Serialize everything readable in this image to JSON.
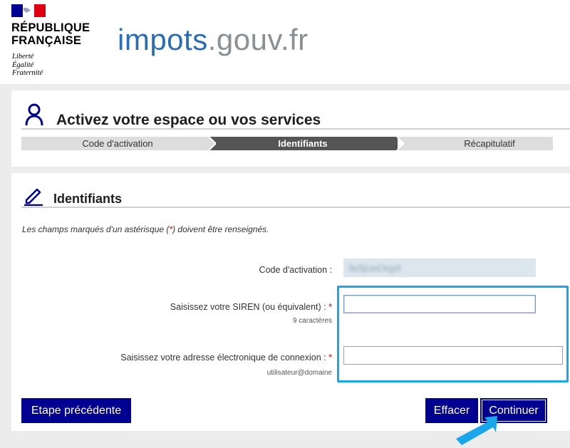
{
  "header": {
    "republic_line1": "RÉPUBLIQUE",
    "republic_line2": "FRANÇAISE",
    "motto": [
      "Liberté",
      "Égalité",
      "Fraternité"
    ],
    "logo_part1": "impots",
    "logo_part2": ".gouv.fr"
  },
  "activation": {
    "title": "Activez votre espace ou vos services",
    "steps": [
      {
        "label": "Code d'activation",
        "state": "done"
      },
      {
        "label": "Identifiants",
        "state": "current"
      },
      {
        "label": "Récapitulatif",
        "state": "todo"
      }
    ]
  },
  "form": {
    "section_title": "Identifiants",
    "note_before": "Les champs marqués d'un astérisque (",
    "note_star": "*",
    "note_after": ") doivent être renseignés.",
    "fields": {
      "activation_code": {
        "label": "Code d'activation :",
        "value": "3e5jUeCkgxf"
      },
      "siren": {
        "label": "Saisissez votre SIREN (ou équivalent) :",
        "required": "*",
        "hint": "9 caractères",
        "value": ""
      },
      "email": {
        "label": "Saisissez votre adresse électronique de connexion :",
        "required": "*",
        "hint": "utilisateur@domaine",
        "value": ""
      }
    }
  },
  "buttons": {
    "back": "Etape précédente",
    "clear": "Effacer",
    "next": "Continuer"
  },
  "colors": {
    "primary": "#000091",
    "brand_blue": "#2b6db3",
    "highlight": "#1aa6ea",
    "required": "#d40000"
  }
}
